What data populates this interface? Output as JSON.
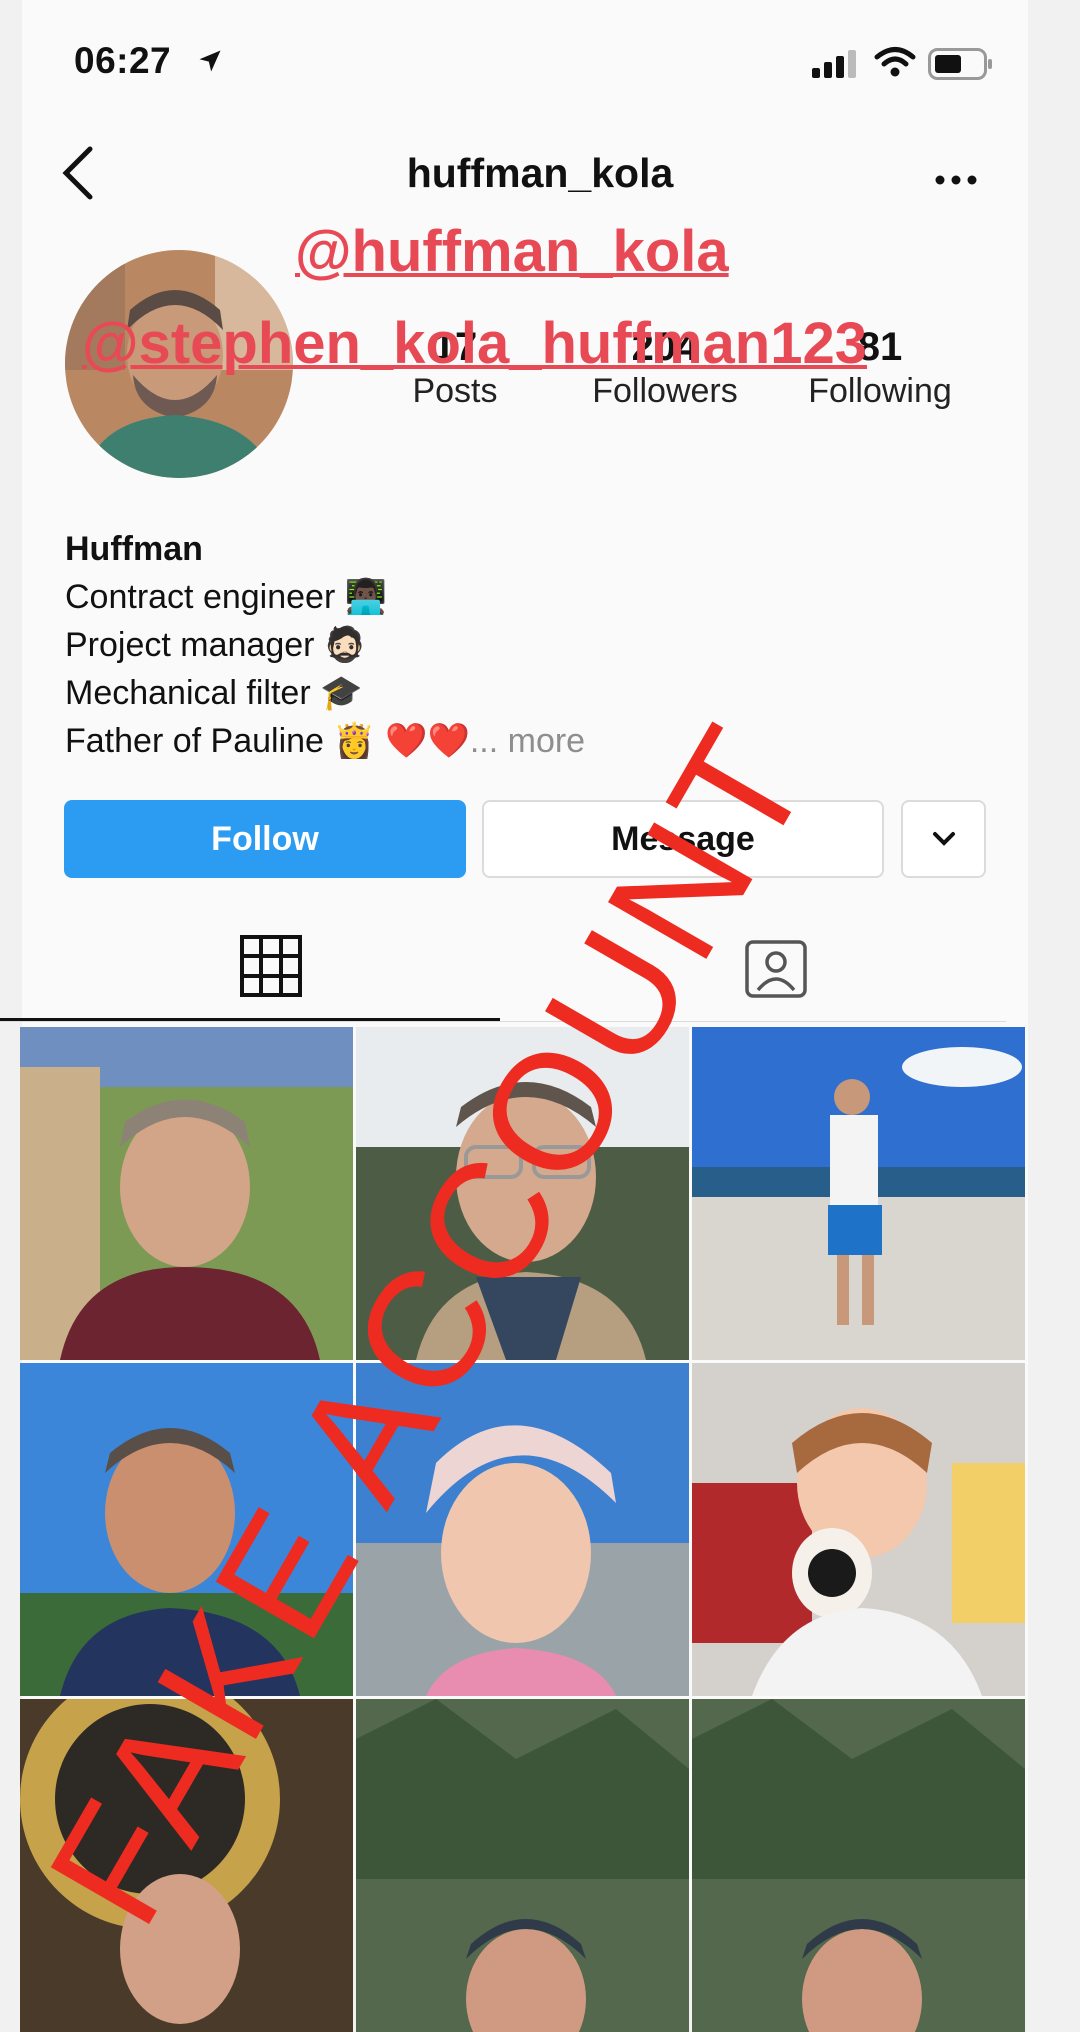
{
  "status_bar": {
    "time": "06:27"
  },
  "header": {
    "username": "huffman_kola"
  },
  "overlay": {
    "handle_1": "@huffman_kola",
    "handle_2": "@stephen_kola_huffman123",
    "stamp": "FAKE ACCOUNT",
    "stamp_color": "#ee2b20",
    "handle_color": "#e84a55"
  },
  "stats": {
    "posts_count": "17",
    "posts_label": "Posts",
    "followers_count": "204",
    "followers_label": "Followers",
    "following_count": "81",
    "following_label": "Following"
  },
  "bio": {
    "name": "Huffman",
    "line1": "Contract engineer 👨🏿‍💻",
    "line2": "Project manager 🧔🏻",
    "line3": "Mechanical filter 🎓",
    "line4": "Father of Pauline 👸 ❤️❤️",
    "more": "... more"
  },
  "actions": {
    "follow_label": "Follow",
    "message_label": "Message",
    "follow_color": "#2b9cf2"
  },
  "tabs": {
    "grid_icon": "grid-icon",
    "tagged_icon": "tagged-person-icon"
  },
  "posts": [
    {
      "alt": "selfie-man-balcony"
    },
    {
      "alt": "selfie-man-glasses-scarf"
    },
    {
      "alt": "man-seaside-pier"
    },
    {
      "alt": "selfie-man-blue-sky"
    },
    {
      "alt": "girl-pink-bandana"
    },
    {
      "alt": "girl-spider-candy"
    },
    {
      "alt": "man-gold-sign"
    },
    {
      "alt": "man-pine-tree"
    },
    {
      "alt": "man-pine-tree-2"
    }
  ]
}
